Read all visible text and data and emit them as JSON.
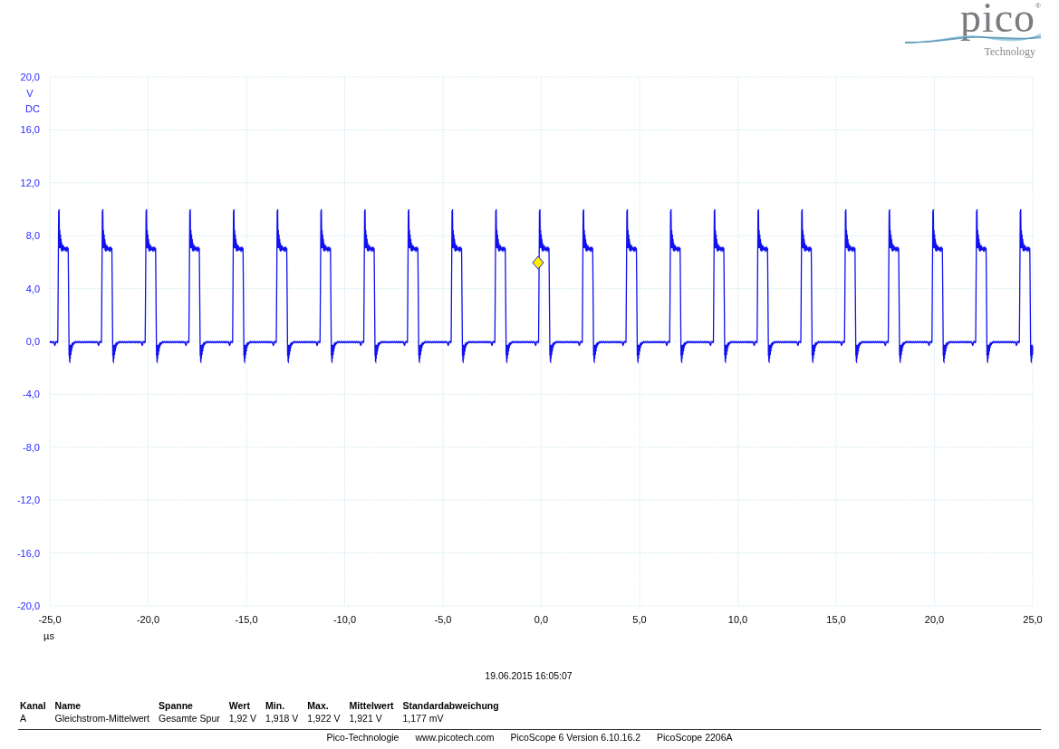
{
  "logo": {
    "wordmark": "pico",
    "registered": "®",
    "tagline": "Technology"
  },
  "chart": {
    "y_ticks": [
      "20,0",
      "16,0",
      "12,0",
      "8,0",
      "4,0",
      "0,0",
      "-4,0",
      "-8,0",
      "-12,0",
      "-16,0",
      "-20,0"
    ],
    "y_unit": "V",
    "y_coupling": "DC",
    "x_ticks": [
      "-25,0",
      "-20,0",
      "-15,0",
      "-10,0",
      "-5,0",
      "0,0",
      "5,0",
      "10,0",
      "15,0",
      "20,0",
      "25,0"
    ],
    "x_unit": "µs"
  },
  "timestamp": "19.06.2015 16:05:07",
  "measurements": {
    "columns": [
      "Kanal",
      "Name",
      "Spanne",
      "Wert",
      "Min.",
      "Max.",
      "Mittelwert",
      "Standardabweichung"
    ],
    "rows": [
      [
        "A",
        "Gleichstrom-Mittelwert",
        "Gesamte Spur",
        "1,92 V",
        "1,918 V",
        "1,922 V",
        "1,921 V",
        "1,177 mV"
      ]
    ]
  },
  "footer": [
    "Pico-Technologie",
    "www.picotech.com",
    "PicoScope 6 Version 6.10.16.2",
    "PicoScope 2206A"
  ]
}
